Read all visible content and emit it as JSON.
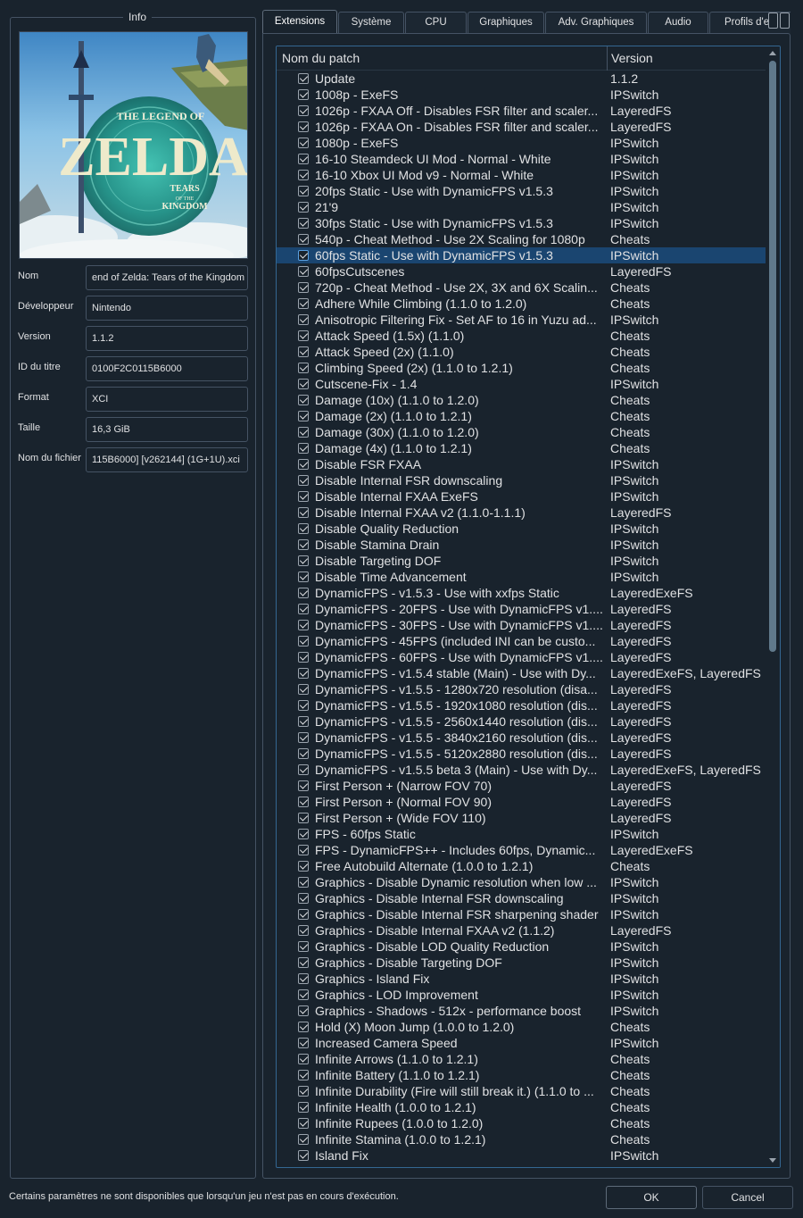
{
  "info": {
    "title": "Info",
    "cover": {
      "brand_line1": "THE LEGEND OF",
      "brand_line2": "ZELDA",
      "brand_line3": "TEARS",
      "brand_line4": "OF THE",
      "brand_line5": "KINGDOM"
    },
    "fields": [
      {
        "label": "Nom",
        "value": "end of Zelda: Tears of the Kingdom"
      },
      {
        "label": "Développeur",
        "value": "Nintendo"
      },
      {
        "label": "Version",
        "value": "1.1.2"
      },
      {
        "label": "ID du titre",
        "value": "0100F2C0115B6000"
      },
      {
        "label": "Format",
        "value": "XCI"
      },
      {
        "label": "Taille",
        "value": "16,3 GiB"
      },
      {
        "label": "Nom du fichier",
        "value": "115B6000] [v262144] (1G+1U).xci"
      }
    ]
  },
  "tabs": [
    {
      "label": "Extensions",
      "active": true
    },
    {
      "label": "Système",
      "active": false
    },
    {
      "label": "CPU",
      "active": false
    },
    {
      "label": "Graphiques",
      "active": false
    },
    {
      "label": "Adv. Graphiques",
      "active": false
    },
    {
      "label": "Audio",
      "active": false
    },
    {
      "label": "Profils d'en",
      "active": false
    }
  ],
  "table": {
    "col_name": "Nom du patch",
    "col_version": "Version",
    "selected_index": 11,
    "rows": [
      {
        "name": "Update",
        "version": "1.1.2"
      },
      {
        "name": "1008p - ExeFS",
        "version": "IPSwitch"
      },
      {
        "name": "1026p - FXAA Off - Disables FSR filter and scaler...",
        "version": "LayeredFS"
      },
      {
        "name": "1026p - FXAA On - Disables FSR filter and scaler...",
        "version": "LayeredFS"
      },
      {
        "name": "1080p - ExeFS",
        "version": "IPSwitch"
      },
      {
        "name": "16-10 Steamdeck UI Mod - Normal - White",
        "version": "IPSwitch"
      },
      {
        "name": "16-10 Xbox UI Mod v9 - Normal - White",
        "version": "IPSwitch"
      },
      {
        "name": "20fps Static  - Use with DynamicFPS v1.5.3",
        "version": "IPSwitch"
      },
      {
        "name": "21'9",
        "version": "IPSwitch"
      },
      {
        "name": "30fps Static  - Use with DynamicFPS v1.5.3",
        "version": "IPSwitch"
      },
      {
        "name": "540p - Cheat Method - Use 2X Scaling for 1080p",
        "version": "Cheats"
      },
      {
        "name": "60fps Static  - Use with DynamicFPS v1.5.3",
        "version": "IPSwitch"
      },
      {
        "name": "60fpsCutscenes",
        "version": "LayeredFS"
      },
      {
        "name": "720p - Cheat Method - Use 2X, 3X and 6X Scalin...",
        "version": "Cheats"
      },
      {
        "name": "Adhere While Climbing (1.1.0 to 1.2.0)",
        "version": "Cheats"
      },
      {
        "name": "Anisotropic Filtering Fix - Set AF to 16 in Yuzu ad...",
        "version": "IPSwitch"
      },
      {
        "name": "Attack Speed (1.5x) (1.1.0)",
        "version": "Cheats"
      },
      {
        "name": "Attack Speed (2x) (1.1.0)",
        "version": "Cheats"
      },
      {
        "name": "Climbing Speed (2x) (1.1.0 to 1.2.1)",
        "version": "Cheats"
      },
      {
        "name": "Cutscene-Fix - 1.4",
        "version": "IPSwitch"
      },
      {
        "name": "Damage (10x) (1.1.0 to 1.2.0)",
        "version": "Cheats"
      },
      {
        "name": "Damage (2x) (1.1.0 to 1.2.1)",
        "version": "Cheats"
      },
      {
        "name": "Damage (30x) (1.1.0 to 1.2.0)",
        "version": "Cheats"
      },
      {
        "name": "Damage (4x) (1.1.0 to 1.2.1)",
        "version": "Cheats"
      },
      {
        "name": "Disable FSR FXAA",
        "version": "IPSwitch"
      },
      {
        "name": "Disable Internal FSR downscaling",
        "version": "IPSwitch"
      },
      {
        "name": "Disable Internal FXAA ExeFS",
        "version": "IPSwitch"
      },
      {
        "name": "Disable Internal FXAA v2 (1.1.0-1.1.1)",
        "version": "LayeredFS"
      },
      {
        "name": "Disable Quality Reduction",
        "version": "IPSwitch"
      },
      {
        "name": "Disable Stamina Drain",
        "version": "IPSwitch"
      },
      {
        "name": "Disable Targeting DOF",
        "version": "IPSwitch"
      },
      {
        "name": "Disable Time Advancement",
        "version": "IPSwitch"
      },
      {
        "name": "DynamicFPS  - v1.5.3 - Use with xxfps Static",
        "version": "LayeredExeFS"
      },
      {
        "name": "DynamicFPS - 20FPS - Use with DynamicFPS v1....",
        "version": "LayeredFS"
      },
      {
        "name": "DynamicFPS - 30FPS - Use with DynamicFPS v1....",
        "version": "LayeredFS"
      },
      {
        "name": "DynamicFPS - 45FPS (included INI can be custo...",
        "version": "LayeredFS"
      },
      {
        "name": "DynamicFPS - 60FPS - Use with DynamicFPS v1....",
        "version": "LayeredFS"
      },
      {
        "name": "DynamicFPS - v1.5.4 stable (Main) - Use with Dy...",
        "version": "LayeredExeFS, LayeredFS"
      },
      {
        "name": "DynamicFPS - v1.5.5 - 1280x720 resolution (disa...",
        "version": "LayeredFS"
      },
      {
        "name": "DynamicFPS - v1.5.5 - 1920x1080 resolution (dis...",
        "version": "LayeredFS"
      },
      {
        "name": "DynamicFPS - v1.5.5 - 2560x1440 resolution (dis...",
        "version": "LayeredFS"
      },
      {
        "name": "DynamicFPS - v1.5.5 - 3840x2160 resolution (dis...",
        "version": "LayeredFS"
      },
      {
        "name": "DynamicFPS - v1.5.5 - 5120x2880 resolution (dis...",
        "version": "LayeredFS"
      },
      {
        "name": "DynamicFPS - v1.5.5 beta 3 (Main) - Use with Dy...",
        "version": "LayeredExeFS, LayeredFS"
      },
      {
        "name": "First Person + (Narrow FOV 70)",
        "version": "LayeredFS"
      },
      {
        "name": "First Person + (Normal FOV 90)",
        "version": "LayeredFS"
      },
      {
        "name": "First Person + (Wide FOV 110)",
        "version": "LayeredFS"
      },
      {
        "name": "FPS - 60fps Static",
        "version": "IPSwitch"
      },
      {
        "name": "FPS - DynamicFPS++ - Includes 60fps, Dynamic...",
        "version": "LayeredExeFS"
      },
      {
        "name": "Free Autobuild Alternate (1.0.0 to 1.2.1)",
        "version": "Cheats"
      },
      {
        "name": "Graphics - Disable Dynamic resolution when low ...",
        "version": "IPSwitch"
      },
      {
        "name": "Graphics - Disable Internal FSR downscaling",
        "version": "IPSwitch"
      },
      {
        "name": "Graphics - Disable Internal FSR sharpening shader",
        "version": "IPSwitch"
      },
      {
        "name": "Graphics - Disable Internal FXAA v2 (1.1.2)",
        "version": "LayeredFS"
      },
      {
        "name": "Graphics - Disable LOD Quality Reduction",
        "version": "IPSwitch"
      },
      {
        "name": "Graphics - Disable Targeting DOF",
        "version": "IPSwitch"
      },
      {
        "name": "Graphics - Island Fix",
        "version": "IPSwitch"
      },
      {
        "name": "Graphics - LOD Improvement",
        "version": "IPSwitch"
      },
      {
        "name": "Graphics - Shadows - 512x - performance boost",
        "version": "IPSwitch"
      },
      {
        "name": "Hold (X) Moon Jump (1.0.0 to 1.2.0)",
        "version": "Cheats"
      },
      {
        "name": "Increased Camera Speed",
        "version": "IPSwitch"
      },
      {
        "name": "Infinite Arrows (1.1.0 to 1.2.1)",
        "version": "Cheats"
      },
      {
        "name": "Infinite Battery (1.1.0 to 1.2.1)",
        "version": "Cheats"
      },
      {
        "name": "Infinite Durability (Fire will still break it.) (1.1.0 to ...",
        "version": "Cheats"
      },
      {
        "name": "Infinite Health (1.0.0 to 1.2.1)",
        "version": "Cheats"
      },
      {
        "name": "Infinite Rupees (1.0.0 to 1.2.0)",
        "version": "Cheats"
      },
      {
        "name": "Infinite Stamina (1.0.0 to 1.2.1)",
        "version": "Cheats"
      },
      {
        "name": "Island Fix",
        "version": "IPSwitch"
      }
    ]
  },
  "footer": {
    "status": "Certains paramètres ne sont disponibles que lorsqu'un jeu n'est pas en cours d'exécution.",
    "ok_label": "OK",
    "cancel_label": "Cancel"
  },
  "colors": {
    "background": "#19232d",
    "border": "#455364",
    "selection": "#1a4570",
    "focus_border": "#346792",
    "cover_emblem": "#2ea89a"
  }
}
